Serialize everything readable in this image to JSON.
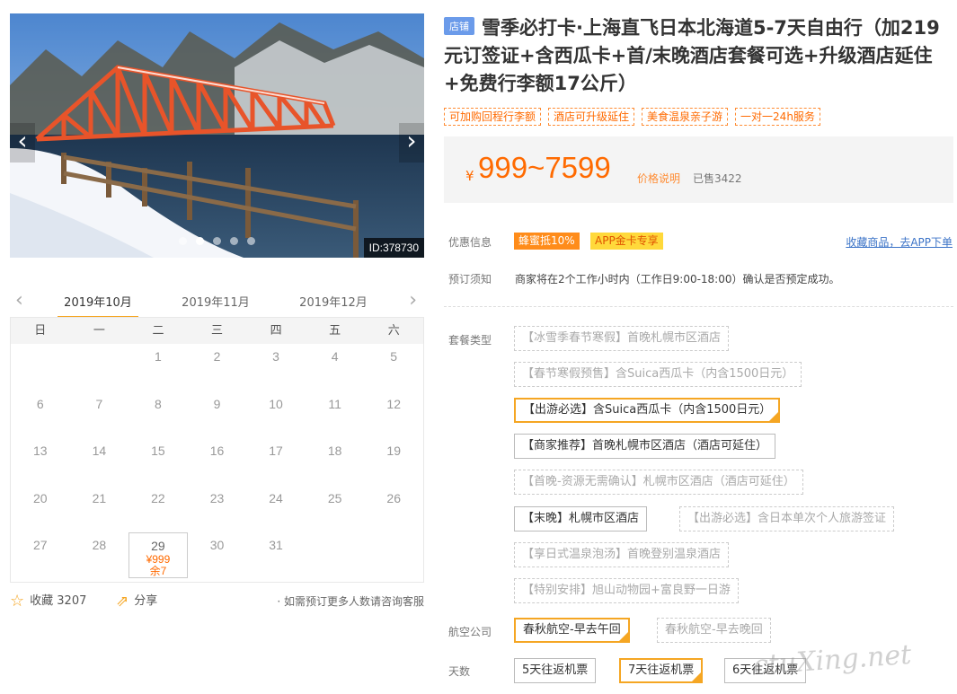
{
  "hero": {
    "image_id": "ID:378730",
    "prev_icon": "chevron-left-icon",
    "next_icon": "chevron-right-icon",
    "slide_count": 5,
    "active_slide": 1
  },
  "calendar": {
    "months": [
      "2019年10月",
      "2019年11月",
      "2019年12月"
    ],
    "active_month": 0,
    "weekdays": [
      "日",
      "一",
      "二",
      "三",
      "四",
      "五",
      "六"
    ],
    "days": [
      {
        "d": ""
      },
      {
        "d": ""
      },
      {
        "d": "1"
      },
      {
        "d": "2"
      },
      {
        "d": "3"
      },
      {
        "d": "4"
      },
      {
        "d": "5"
      },
      {
        "d": "6"
      },
      {
        "d": "7"
      },
      {
        "d": "8"
      },
      {
        "d": "9"
      },
      {
        "d": "10"
      },
      {
        "d": "11"
      },
      {
        "d": "12"
      },
      {
        "d": "13"
      },
      {
        "d": "14"
      },
      {
        "d": "15"
      },
      {
        "d": "16"
      },
      {
        "d": "17"
      },
      {
        "d": "18"
      },
      {
        "d": "19"
      },
      {
        "d": "20"
      },
      {
        "d": "21"
      },
      {
        "d": "22"
      },
      {
        "d": "23"
      },
      {
        "d": "24"
      },
      {
        "d": "25"
      },
      {
        "d": "26"
      },
      {
        "d": "27"
      },
      {
        "d": "28"
      },
      {
        "d": "29",
        "price": "¥999",
        "stock": "余7"
      },
      {
        "d": "30"
      },
      {
        "d": "31"
      }
    ]
  },
  "footer": {
    "fav_label": "收藏 3207",
    "share_label": "分享",
    "note": "· 如需预订更多人数请咨询客服"
  },
  "product": {
    "shop_badge": "店铺",
    "title": "雪季必打卡·上海直飞日本北海道5-7天自由行（加219元订签证+含西瓜卡+首/末晚酒店套餐可选+升级酒店延住+免费行李额17公斤）",
    "tags": [
      "可加购回程行李额",
      "酒店可升级延住",
      "美食温泉亲子游",
      "一对一24h服务"
    ]
  },
  "price": {
    "currency": "¥",
    "range": "999~7599",
    "explain": "价格说明",
    "sold": "已售3422"
  },
  "promo": {
    "label": "优惠信息",
    "badge1": "蜂蜜抵10%",
    "badge2": "APP金卡专享",
    "fav_link": "收藏商品，去APP下单"
  },
  "booking": {
    "label": "预订须知",
    "text": "商家将在2个工作小时内（工作日9:00-18:00）确认是否预定成功。"
  },
  "package": {
    "label": "套餐类型",
    "options": [
      {
        "text": "【冰雪季春节寒假】首晚札幌市区酒店",
        "state": "disabled"
      },
      {
        "text": "【春节寒假预售】含Suica西瓜卡（内含1500日元）",
        "state": "disabled"
      },
      {
        "text": "【出游必选】含Suica西瓜卡（内含1500日元）",
        "state": "selected"
      },
      {
        "text": "【商家推荐】首晚札幌市区酒店（酒店可延住）",
        "state": "normal"
      },
      {
        "text": "【首晚-资源无需确认】札幌市区酒店（酒店可延住）",
        "state": "disabled"
      },
      {
        "text": "【末晚】札幌市区酒店",
        "state": "normal"
      },
      {
        "text": "【出游必选】含日本单次个人旅游签证",
        "state": "disabled"
      },
      {
        "text": "【享日式温泉泡汤】首晚登别温泉酒店",
        "state": "disabled"
      },
      {
        "text": "【特别安排】旭山动物园+富良野一日游",
        "state": "disabled"
      }
    ]
  },
  "airline": {
    "label": "航空公司",
    "options": [
      {
        "text": "春秋航空-早去午回",
        "state": "selected"
      },
      {
        "text": "春秋航空-早去晚回",
        "state": "disabled"
      }
    ]
  },
  "days_opt": {
    "label": "天数",
    "options": [
      {
        "text": "5天往返机票",
        "state": "normal"
      },
      {
        "text": "7天往返机票",
        "state": "selected"
      },
      {
        "text": "6天往返机票",
        "state": "normal"
      }
    ]
  },
  "watermark": "ctuXing.net",
  "colors": {
    "accent": "#ff6a00",
    "selected_border": "#f5a623",
    "badge_blue": "#6b9bea"
  }
}
